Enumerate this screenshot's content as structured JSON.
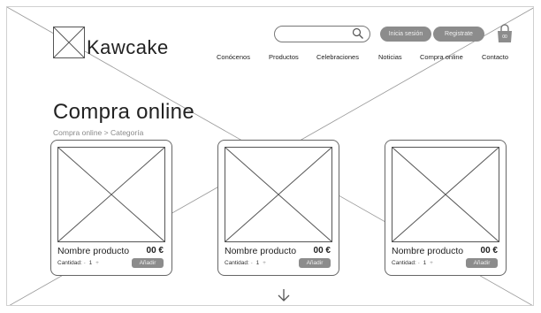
{
  "header": {
    "logo": {
      "text": "Kawcake"
    },
    "search": {
      "placeholder": "",
      "icon": "search-icon"
    },
    "login_label": "Inicia sesión",
    "register_label": "Registrate",
    "cart": {
      "icon": "shopping-bag-icon",
      "count": "00"
    },
    "nav": [
      {
        "label": "Conócenos"
      },
      {
        "label": "Productos"
      },
      {
        "label": "Celebraciones"
      },
      {
        "label": "Noticias"
      },
      {
        "label": "Compra online"
      },
      {
        "label": "Contacto"
      }
    ]
  },
  "main": {
    "title": "Compra online",
    "breadcrumb": "Compra online > Categoría",
    "products": [
      {
        "name": "Nombre producto",
        "price": "00 €",
        "qty_label": "Cantidad:",
        "qty_minus": "-",
        "qty": "1",
        "qty_plus": "+",
        "add_label": "Añadir"
      },
      {
        "name": "Nombre producto",
        "price": "00 €",
        "qty_label": "Cantidad:",
        "qty_minus": "-",
        "qty": "1",
        "qty_plus": "+",
        "add_label": "Añadir"
      },
      {
        "name": "Nombre producto",
        "price": "00 €",
        "qty_label": "Cantidad:",
        "qty_minus": "-",
        "qty": "1",
        "qty_plus": "+",
        "add_label": "Añadir"
      }
    ],
    "scroll_icon": "arrow-down-icon"
  },
  "colors": {
    "button_bg": "#8c8c8c",
    "border": "#666666",
    "muted_text": "#8a8a8a"
  }
}
